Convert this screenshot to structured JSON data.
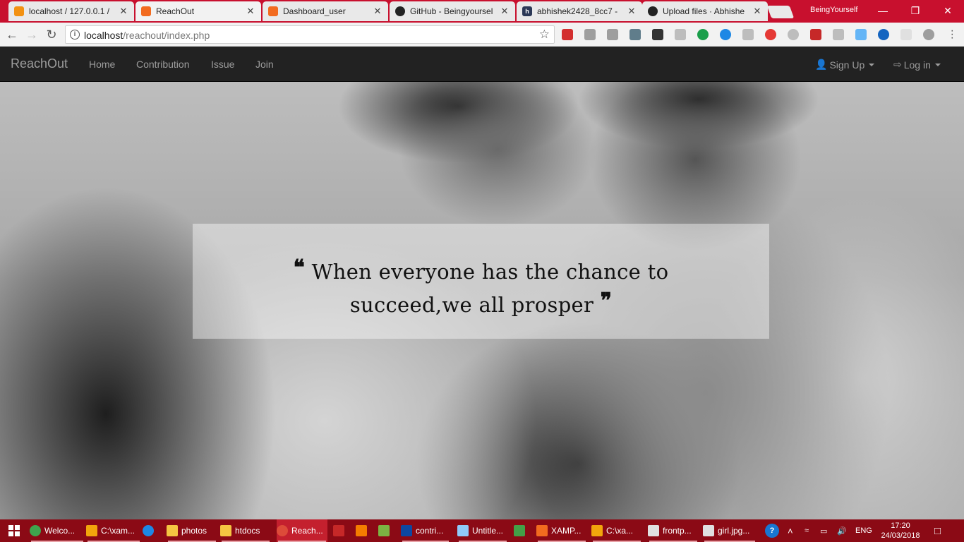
{
  "browser": {
    "tabs": [
      {
        "title": "localhost / 127.0.0.1 /",
        "color": "#f29111",
        "icon": "phpmyadmin-icon"
      },
      {
        "title": "ReachOut",
        "color": "#f26b1f",
        "icon": "xampp-icon",
        "active": true
      },
      {
        "title": "Dashboard_user",
        "color": "#f26b1f",
        "icon": "xampp-icon"
      },
      {
        "title": "GitHub - Beingyoursel",
        "color": "#222222",
        "icon": "github-icon"
      },
      {
        "title": "abhishek2428_8cc7 - ",
        "color": "#2b3856",
        "icon": "hackerearth-icon"
      },
      {
        "title": "Upload files · Abhishe",
        "color": "#222222",
        "icon": "github-icon"
      }
    ],
    "profile_name": "BeingYourself",
    "url_host": "localhost",
    "url_path": "/reachout/index.php"
  },
  "navbar": {
    "brand": "ReachOut",
    "links": [
      "Home",
      "Contribution",
      "Issue",
      "Join"
    ],
    "signup": "Sign Up",
    "login": "Log in"
  },
  "hero": {
    "quote_line1": "When everyone has the chance to",
    "quote_line2": "succeed,we all prosper",
    "open_mark": "❝",
    "close_mark": "❞"
  },
  "taskbar": {
    "items": [
      {
        "label": "Welco...",
        "color": "#3fa34d"
      },
      {
        "label": "C:\\xam...",
        "color": "#f2a50c"
      },
      {
        "label": "",
        "color": "#1e88e5"
      },
      {
        "label": "photos",
        "color": "#f5c542"
      },
      {
        "label": "htdocs",
        "color": "#f5c542"
      },
      {
        "label": "Reach...",
        "color": "#dd4b39"
      },
      {
        "label": "",
        "color": "#c62828"
      },
      {
        "label": "",
        "color": "#f57c00"
      },
      {
        "label": "",
        "color": "#7cb342"
      },
      {
        "label": "contri...",
        "color": "#0d47a1"
      },
      {
        "label": "Untitle...",
        "color": "#90caf9"
      },
      {
        "label": "",
        "color": "#43a047"
      },
      {
        "label": "XAMP...",
        "color": "#f26b1f"
      },
      {
        "label": "C:\\xa...",
        "color": "#f2a50c"
      },
      {
        "label": "frontp...",
        "color": "#e0e0e0"
      },
      {
        "label": "girl.jpg...",
        "color": "#e0e0e0"
      }
    ],
    "language": "ENG",
    "time": "17:20",
    "date": "24/03/2018"
  }
}
